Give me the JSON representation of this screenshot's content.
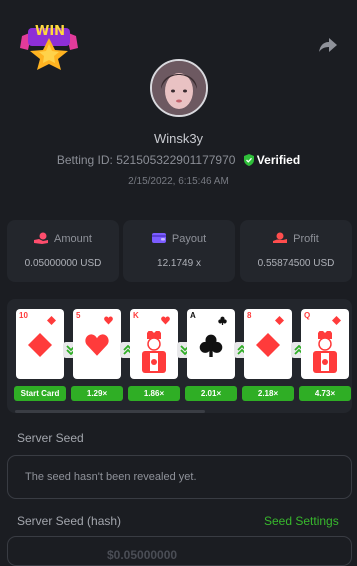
{
  "header": {
    "logo_text": "WIN",
    "logo_icon": "win-star-logo",
    "share_icon": "share-icon"
  },
  "profile": {
    "username": "Winsk3y",
    "betting_id_label": "Betting ID: 521505322901177970",
    "verified_label": "Verified",
    "datetime": "2/15/2022, 6:15:46 AM"
  },
  "stats": {
    "amount": {
      "label": "Amount",
      "value": "0.05000000 USD",
      "icon": "coins-hand-icon",
      "color": "#ff4d6d"
    },
    "payout": {
      "label": "Payout",
      "value": "12.1749 x",
      "icon": "wallet-icon",
      "color": "#7b5cff"
    },
    "profit": {
      "label": "Profit",
      "value": "0.55874500 USD",
      "icon": "hand-coin-icon",
      "color": "#ff4d4d"
    }
  },
  "cards": [
    {
      "rank": "10",
      "suit": "diamond",
      "color": "#ff3b3b",
      "multiplier": "Start Card",
      "arrow_after": "down"
    },
    {
      "rank": "5",
      "suit": "heart",
      "color": "#ff3b3b",
      "multiplier": "1.29×",
      "arrow_after": "up"
    },
    {
      "rank": "K",
      "suit": "heart-king",
      "color": "#ff3b3b",
      "multiplier": "1.86×",
      "arrow_after": "down"
    },
    {
      "rank": "A",
      "suit": "club",
      "color": "#111111",
      "multiplier": "2.01×",
      "arrow_after": "up"
    },
    {
      "rank": "8",
      "suit": "diamond",
      "color": "#ff3b3b",
      "multiplier": "2.18×",
      "arrow_after": "up"
    },
    {
      "rank": "Q",
      "suit": "diamond-queen",
      "color": "#ff3b3b",
      "multiplier": "4.73×",
      "arrow_after": null
    }
  ],
  "seed": {
    "server_seed_label": "Server Seed",
    "server_seed_value": "The seed hasn't been revealed yet.",
    "hash_label": "Server Seed (hash)",
    "settings_link": "Seed Settings",
    "hash_peek": "$0.05000000"
  },
  "colors": {
    "background": "#1b1d22",
    "panel": "#23262c",
    "accent_green": "#2fae25",
    "link_green": "#38b82d"
  }
}
